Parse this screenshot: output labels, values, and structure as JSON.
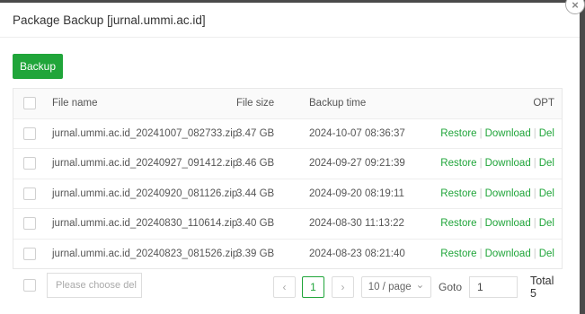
{
  "dialog": {
    "title": "Package Backup [jurnal.ummi.ac.id]",
    "close_icon": "×",
    "backup_label": "Backup"
  },
  "table": {
    "columns": {
      "name": "File name",
      "size": "File size",
      "time": "Backup time",
      "opt": "OPT"
    },
    "rows": [
      {
        "name": "jurnal.ummi.ac.id_20241007_082733.zip",
        "size": "3.47 GB",
        "time": "2024-10-07 08:36:37"
      },
      {
        "name": "jurnal.ummi.ac.id_20240927_091412.zip",
        "size": "3.46 GB",
        "time": "2024-09-27 09:21:39"
      },
      {
        "name": "jurnal.ummi.ac.id_20240920_081126.zip",
        "size": "3.44 GB",
        "time": "2024-09-20 08:19:11"
      },
      {
        "name": "jurnal.ummi.ac.id_20240830_110614.zip",
        "size": "3.40 GB",
        "time": "2024-08-30 11:13:22"
      },
      {
        "name": "jurnal.ummi.ac.id_20240823_081526.zip",
        "size": "3.39 GB",
        "time": "2024-08-23 08:21:40"
      }
    ],
    "actions": {
      "restore": "Restore",
      "download": "Download",
      "del": "Del",
      "separator": "|"
    }
  },
  "footer": {
    "batch_placeholder": "Please choose del",
    "prev_icon": "‹",
    "next_icon": "›",
    "current_page": "1",
    "page_size": "10 / page",
    "chevron_icon": "⌄",
    "goto_label": "Goto",
    "goto_value": "1",
    "total": "Total 5"
  },
  "colors": {
    "accent": "#20a53a",
    "overlay": "#4a4a4a"
  }
}
